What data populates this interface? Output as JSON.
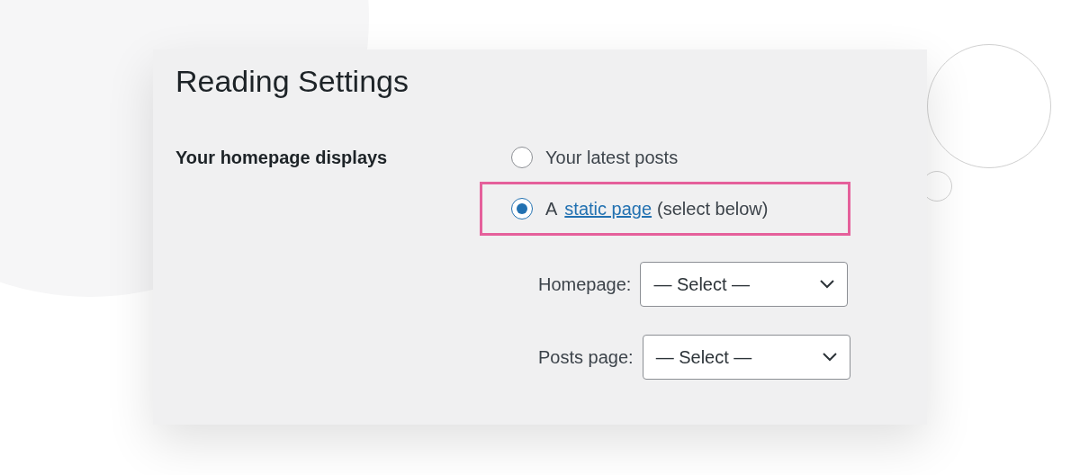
{
  "title": "Reading Settings",
  "setting": {
    "label": "Your homepage displays",
    "options": [
      {
        "kind": "plain",
        "text": "Your latest posts",
        "selected": false,
        "highlighted": false
      },
      {
        "kind": "link",
        "prefix": "A",
        "link": "static page",
        "suffix": "(select below)",
        "selected": true,
        "highlighted": true
      }
    ],
    "selects": [
      {
        "label": "Homepage:",
        "value": "— Select —"
      },
      {
        "label": "Posts page:",
        "value": "— Select —"
      }
    ]
  }
}
